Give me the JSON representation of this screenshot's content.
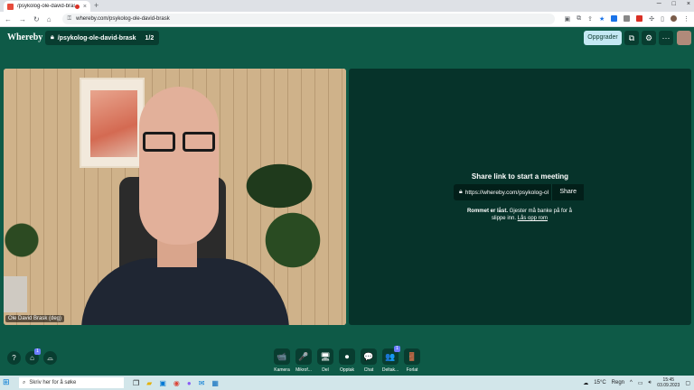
{
  "browser": {
    "tab_title": "/psykolog-ole-david-brask",
    "tab_close": "×",
    "new_tab": "+",
    "url": "whereby.com/psykolog-ole-david-brask",
    "window_controls": [
      "─",
      "□",
      "×"
    ]
  },
  "app": {
    "logo": "Whereby",
    "room_name": "/psykolog-ole-david-brask",
    "participant_count": "1/2",
    "upgrade_label": "Oppgrader",
    "more_icon": "···"
  },
  "video": {
    "participant_label": "Ole David Brask (deg)"
  },
  "share": {
    "title": "Share link to start a meeting",
    "link_value": "https://whereby.com/psykolog-ol",
    "button_label": "Share",
    "locked_bold": "Rommet er låst.",
    "locked_text": " Gjester må banke på for å slippe inn. ",
    "unlock_link": "Lås opp rom"
  },
  "left_controls": {
    "help": "?",
    "badge": "1"
  },
  "controls": [
    {
      "label": "Kamera",
      "icon": "📹"
    },
    {
      "label": "Mikrof...",
      "icon": "🎤"
    },
    {
      "label": "Del",
      "icon": "🖥"
    },
    {
      "label": "Opptak",
      "icon": "⏺"
    },
    {
      "label": "Chat",
      "icon": "💬"
    },
    {
      "label": "Deltak...",
      "icon": "👥",
      "badge": "1"
    },
    {
      "label": "Forlat",
      "icon": "🚪"
    }
  ],
  "taskbar": {
    "search_placeholder": "Skriv her for å søke",
    "weather": "15°C",
    "weather_label": "Regn",
    "time": "15:45",
    "date": "03.09.2023"
  },
  "colors": {
    "background": "#0e5a47",
    "panel": "#06332a",
    "upgrade": "#c4e8f3"
  }
}
